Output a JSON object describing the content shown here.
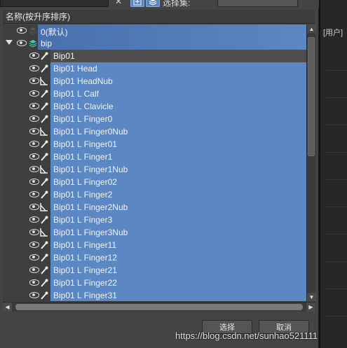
{
  "toolbar": {
    "select_set_label": "选择集:"
  },
  "header": {
    "column_title": "名称(按升序排序)"
  },
  "viewport": {
    "header_text": "[用户]"
  },
  "tree": {
    "layers": [
      {
        "label": "0(默认)"
      },
      {
        "label": "bip"
      }
    ],
    "items": [
      {
        "label": "Bip01",
        "icon": "bone-icon"
      },
      {
        "label": "Bip01 Head",
        "icon": "bone-icon"
      },
      {
        "label": "Bip01 HeadNub",
        "icon": "nub-icon"
      },
      {
        "label": "Bip01 L Calf",
        "icon": "bone-icon"
      },
      {
        "label": "Bip01 L Clavicle",
        "icon": "bone-icon"
      },
      {
        "label": "Bip01 L Finger0",
        "icon": "bone-icon"
      },
      {
        "label": "Bip01 L Finger0Nub",
        "icon": "nub-icon"
      },
      {
        "label": "Bip01 L Finger01",
        "icon": "bone-icon"
      },
      {
        "label": "Bip01 L Finger1",
        "icon": "bone-icon"
      },
      {
        "label": "Bip01 L Finger1Nub",
        "icon": "nub-icon"
      },
      {
        "label": "Bip01 L Finger02",
        "icon": "bone-icon"
      },
      {
        "label": "Bip01 L Finger2",
        "icon": "bone-icon"
      },
      {
        "label": "Bip01 L Finger2Nub",
        "icon": "nub-icon"
      },
      {
        "label": "Bip01 L Finger3",
        "icon": "bone-icon"
      },
      {
        "label": "Bip01 L Finger3Nub",
        "icon": "nub-icon"
      },
      {
        "label": "Bip01 L Finger11",
        "icon": "bone-icon"
      },
      {
        "label": "Bip01 L Finger12",
        "icon": "bone-icon"
      },
      {
        "label": "Bip01 L Finger21",
        "icon": "bone-icon"
      },
      {
        "label": "Bip01 L Finger22",
        "icon": "bone-icon"
      },
      {
        "label": "Bip01 L Finger31",
        "icon": "bone-icon"
      }
    ]
  },
  "buttons": {
    "select_label": "选择",
    "cancel_label": "取消"
  },
  "watermark": "https://blog.csdn.net/sunhao521111",
  "colors": {
    "selection": "#5b87c2",
    "panel": "#444444",
    "list_bg": "#3e3e3e"
  }
}
